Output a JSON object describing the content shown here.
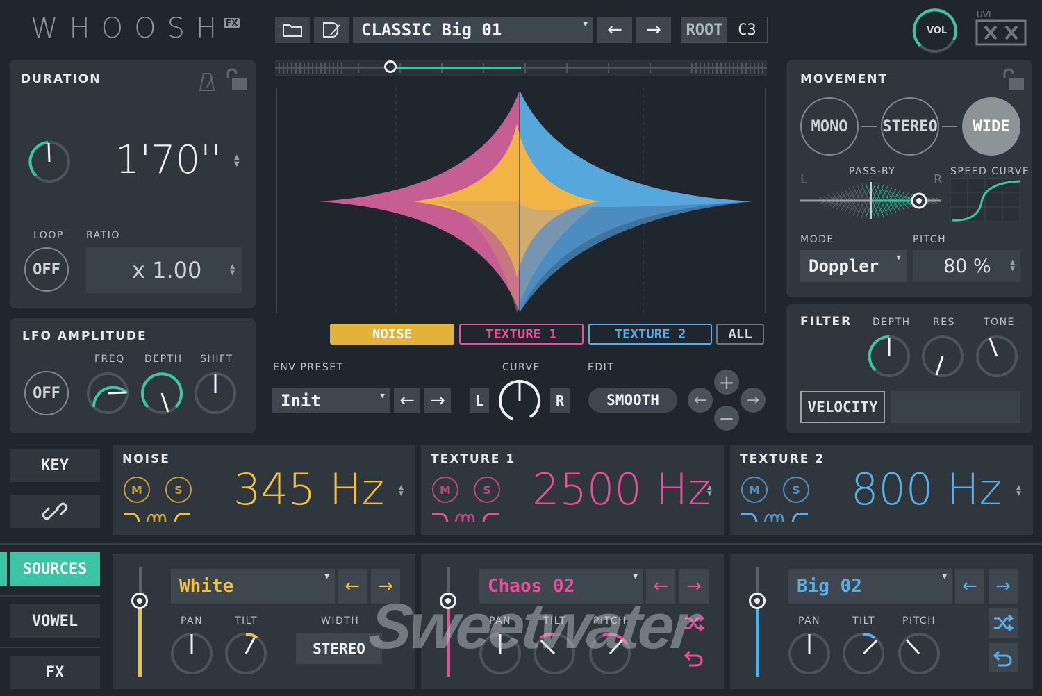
{
  "header": {
    "logo": "WHOOSH",
    "logo_badge": "FX",
    "preset_name": "CLASSIC Big 01",
    "root_label": "ROOT",
    "root_value": "C3",
    "vol_label": "VOL",
    "brand_logo": "UVI"
  },
  "duration": {
    "title": "DURATION",
    "value": "1'70''",
    "loop_label": "LOOP",
    "loop_value": "OFF",
    "ratio_label": "RATIO",
    "ratio_value": "x 1.00"
  },
  "lfo": {
    "title": "LFO AMPLITUDE",
    "off": "OFF",
    "freq": "FREQ",
    "depth": "DEPTH",
    "shift": "SHIFT"
  },
  "layers": {
    "noise": "NOISE",
    "texture1": "TEXTURE 1",
    "texture2": "TEXTURE 2",
    "all": "ALL"
  },
  "env": {
    "preset_label": "ENV PRESET",
    "preset_value": "Init",
    "curve_label": "CURVE",
    "curve_l": "L",
    "curve_r": "R",
    "edit_label": "EDIT",
    "edit_value": "SMOOTH"
  },
  "movement": {
    "title": "MOVEMENT",
    "mono": "MONO",
    "stereo": "STEREO",
    "wide": "WIDE",
    "passby": "PASS-BY",
    "l": "L",
    "r": "R",
    "speed_curve": "SPEED CURVE",
    "mode_label": "MODE",
    "mode_value": "Doppler",
    "pitch_label": "PITCH",
    "pitch_value": "80 %"
  },
  "filter": {
    "title": "FILTER",
    "depth": "DEPTH",
    "res": "RES",
    "tone": "TONE",
    "velocity": "VELOCITY"
  },
  "side": {
    "key": "KEY",
    "sources": "SOURCES",
    "vowel": "VOWEL",
    "fx": "FX"
  },
  "layer_panels": [
    {
      "title": "NOISE",
      "freq": "345 Hz",
      "m": "M",
      "s": "S",
      "color": "#f0c23a"
    },
    {
      "title": "TEXTURE 1",
      "freq": "2500 Hz",
      "m": "M",
      "s": "S",
      "color": "#e84f9a"
    },
    {
      "title": "TEXTURE 2",
      "freq": "800 Hz",
      "m": "M",
      "s": "S",
      "color": "#5aaee6"
    }
  ],
  "sources": [
    {
      "name": "White",
      "pan": "PAN",
      "tilt": "TILT",
      "extra": "WIDTH",
      "extra_value": "STEREO",
      "color": "#f0c23a"
    },
    {
      "name": "Chaos 02",
      "pan": "PAN",
      "tilt": "TILT",
      "extra": "PITCH",
      "color": "#e84f9a"
    },
    {
      "name": "Big 02",
      "pan": "PAN",
      "tilt": "TILT",
      "extra": "PITCH",
      "color": "#5aaee6"
    }
  ],
  "watermark": "Sweetwater",
  "colors": {
    "accent": "#3cc4a6",
    "noise": "#f0c23a",
    "texture1": "#e84f9a",
    "texture2": "#5aaee6"
  }
}
